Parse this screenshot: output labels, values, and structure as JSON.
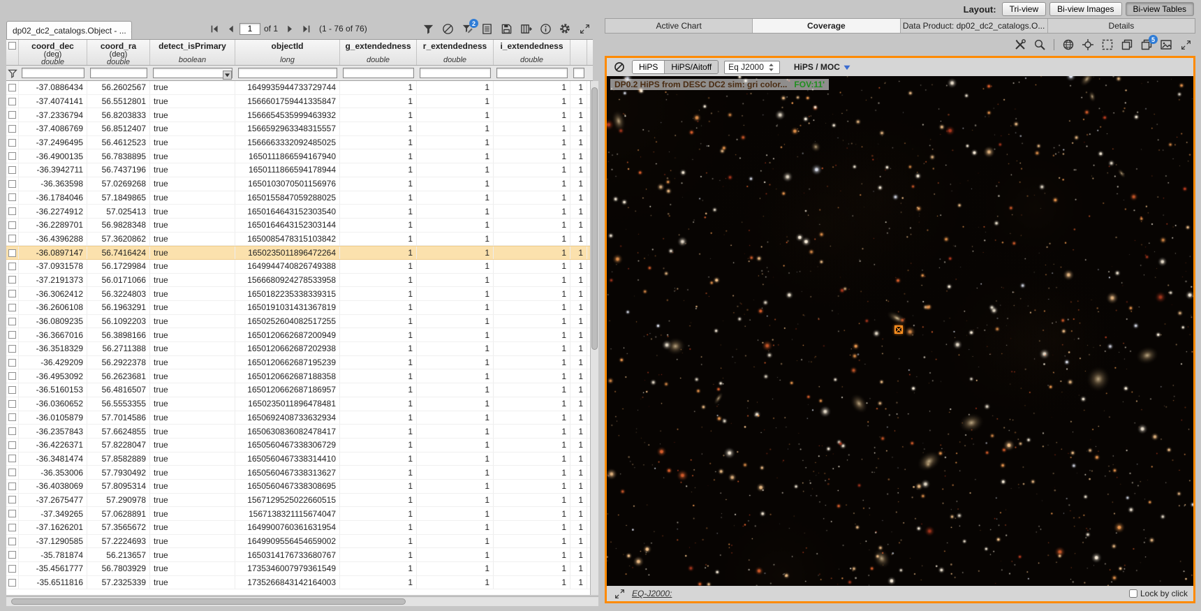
{
  "layout_bar": {
    "label": "Layout:",
    "options": [
      {
        "label": "Tri-view",
        "active": false
      },
      {
        "label": "Bi-view Images",
        "active": false
      },
      {
        "label": "Bi-view Tables",
        "active": true
      }
    ]
  },
  "table_panel": {
    "tab": {
      "title": "dp02_dc2_catalogs.Object - ...",
      "close": "×"
    },
    "paging": {
      "page_value": "1",
      "of_label": "of 1",
      "range_label": "(1 - 76 of 76)"
    },
    "toolbar_icons": [
      "filter-icon",
      "clear-filter-icon",
      "advanced-filter-icon",
      "text-view-icon",
      "save-icon",
      "show-columns-icon",
      "info-icon",
      "options-icon",
      "expand-icon"
    ],
    "filter_badge": "2",
    "columns": [
      {
        "name": "coord_dec",
        "unit": "(deg)",
        "type": "double"
      },
      {
        "name": "coord_ra",
        "unit": "(deg)",
        "type": "double"
      },
      {
        "name": "detect_isPrimary",
        "unit": "",
        "type": "boolean"
      },
      {
        "name": "objectId",
        "unit": "",
        "type": "long"
      },
      {
        "name": "g_extendedness",
        "unit": "",
        "type": "double"
      },
      {
        "name": "r_extendedness",
        "unit": "",
        "type": "double"
      },
      {
        "name": "i_extendedness",
        "unit": "",
        "type": "double"
      },
      {
        "name": "",
        "unit": "",
        "type": ""
      }
    ],
    "highlighted_row": 12,
    "rows": [
      [
        "-37.0886434",
        "56.2602567",
        "true",
        "1649935944733729744",
        "1",
        "1",
        "1",
        "1"
      ],
      [
        "-37.4074141",
        "56.5512801",
        "true",
        "1566601759441335847",
        "1",
        "1",
        "1",
        "1"
      ],
      [
        "-37.2336794",
        "56.8203833",
        "true",
        "1566654535999463932",
        "1",
        "1",
        "1",
        "1"
      ],
      [
        "-37.4086769",
        "56.8512407",
        "true",
        "1566592963348315557",
        "1",
        "1",
        "1",
        "1"
      ],
      [
        "-37.2496495",
        "56.4612523",
        "true",
        "1566663332092485025",
        "1",
        "1",
        "1",
        "1"
      ],
      [
        "-36.4900135",
        "56.7838895",
        "true",
        "1650111866594167940",
        "1",
        "1",
        "1",
        "1"
      ],
      [
        "-36.3942711",
        "56.7437196",
        "true",
        "1650111866594178944",
        "1",
        "1",
        "1",
        "1"
      ],
      [
        "-36.363598",
        "57.0269268",
        "true",
        "1650103070501156976",
        "1",
        "1",
        "1",
        "1"
      ],
      [
        "-36.1784046",
        "57.1849865",
        "true",
        "1650155847059288025",
        "1",
        "1",
        "1",
        "1"
      ],
      [
        "-36.2274912",
        "57.025413",
        "true",
        "1650164643152303540",
        "1",
        "1",
        "1",
        "1"
      ],
      [
        "-36.2289701",
        "56.9828348",
        "true",
        "1650164643152303144",
        "1",
        "1",
        "1",
        "1"
      ],
      [
        "-36.4396288",
        "57.3620862",
        "true",
        "1650085478315103842",
        "1",
        "1",
        "1",
        "1"
      ],
      [
        "-36.0897147",
        "56.7416424",
        "true",
        "1650235011896472264",
        "1",
        "1",
        "1",
        "1"
      ],
      [
        "-37.0931578",
        "56.1729984",
        "true",
        "1649944740826749388",
        "1",
        "1",
        "1",
        "1"
      ],
      [
        "-37.2191373",
        "56.0171066",
        "true",
        "1566680924278533958",
        "1",
        "1",
        "1",
        "1"
      ],
      [
        "-36.3062412",
        "56.3224803",
        "true",
        "1650182235338339315",
        "1",
        "1",
        "1",
        "1"
      ],
      [
        "-36.2606108",
        "56.1963291",
        "true",
        "1650191031431367819",
        "1",
        "1",
        "1",
        "1"
      ],
      [
        "-36.0809235",
        "56.1092203",
        "true",
        "1650252604082517255",
        "1",
        "1",
        "1",
        "1"
      ],
      [
        "-36.3667016",
        "56.3898166",
        "true",
        "1650120662687200949",
        "1",
        "1",
        "1",
        "1"
      ],
      [
        "-36.3518329",
        "56.2711388",
        "true",
        "1650120662687202938",
        "1",
        "1",
        "1",
        "1"
      ],
      [
        "-36.429209",
        "56.2922378",
        "true",
        "1650120662687195239",
        "1",
        "1",
        "1",
        "1"
      ],
      [
        "-36.4953092",
        "56.2623681",
        "true",
        "1650120662687188358",
        "1",
        "1",
        "1",
        "1"
      ],
      [
        "-36.5160153",
        "56.4816507",
        "true",
        "1650120662687186957",
        "1",
        "1",
        "1",
        "1"
      ],
      [
        "-36.0360652",
        "56.5553355",
        "true",
        "1650235011896478481",
        "1",
        "1",
        "1",
        "1"
      ],
      [
        "-36.0105879",
        "57.7014586",
        "true",
        "1650692408733632934",
        "1",
        "1",
        "1",
        "1"
      ],
      [
        "-36.2357843",
        "57.6624855",
        "true",
        "1650630836082478417",
        "1",
        "1",
        "1",
        "1"
      ],
      [
        "-36.4226371",
        "57.8228047",
        "true",
        "1650560467338306729",
        "1",
        "1",
        "1",
        "1"
      ],
      [
        "-36.3481474",
        "57.8582889",
        "true",
        "1650560467338314410",
        "1",
        "1",
        "1",
        "1"
      ],
      [
        "-36.353006",
        "57.7930492",
        "true",
        "1650560467338313627",
        "1",
        "1",
        "1",
        "1"
      ],
      [
        "-36.4038069",
        "57.8095314",
        "true",
        "1650560467338308695",
        "1",
        "1",
        "1",
        "1"
      ],
      [
        "-37.2675477",
        "57.290978",
        "true",
        "1567129525022660515",
        "1",
        "1",
        "1",
        "1"
      ],
      [
        "-37.349265",
        "57.0628891",
        "true",
        "1567138321115674047",
        "1",
        "1",
        "1",
        "1"
      ],
      [
        "-37.1626201",
        "57.3565672",
        "true",
        "1649900760361631954",
        "1",
        "1",
        "1",
        "1"
      ],
      [
        "-37.1290585",
        "57.2224693",
        "true",
        "1649909556454659002",
        "1",
        "1",
        "1",
        "1"
      ],
      [
        "-35.781874",
        "56.213657",
        "true",
        "1650314176733680767",
        "1",
        "1",
        "1",
        "1"
      ],
      [
        "-35.4561777",
        "56.7803929",
        "true",
        "1735346007979361549",
        "1",
        "1",
        "1",
        "1"
      ],
      [
        "-35.6511816",
        "57.2325339",
        "true",
        "1735266843142164003",
        "1",
        "1",
        "1",
        "1"
      ]
    ]
  },
  "right_panel": {
    "tabs": [
      {
        "label": "Active Chart",
        "active": false
      },
      {
        "label": "Coverage",
        "active": true
      },
      {
        "label": "Data Product: dp02_dc2_catalogs.O...",
        "active": false
      },
      {
        "label": "Details",
        "active": false
      }
    ],
    "toolbar_icons": [
      "tools-icon",
      "zoom-icon",
      "divider",
      "grid-icon",
      "recenter-icon",
      "select-area-icon",
      "layers-icon",
      "catalog-overlay-icon",
      "save-image-icon",
      "expand-icon"
    ],
    "catalogs_badge": "5",
    "coverage": {
      "toggle_hips": "HiPS",
      "toggle_aitoff": "HiPS/Aitoff",
      "coord_system": "Eq J2000",
      "moc_label": "HiPS / MOC",
      "status_text": "DP0.2 HiPS from DESC DC2 sim: gri color...",
      "fov_label": "FOV:11'",
      "readout_label": "EQ-J2000:",
      "lock_label": "Lock by click",
      "marker": {
        "x_pct": 49.8,
        "y_pct": 49.7
      },
      "starfield": {
        "seed": 7,
        "stars": 1500,
        "galaxies": 14,
        "background": "#070402",
        "palette": [
          "#f7ecd9",
          "#f2c189",
          "#e8954d",
          "#d95f2c",
          "#b23a1f",
          "#dfe4f2"
        ]
      }
    }
  }
}
